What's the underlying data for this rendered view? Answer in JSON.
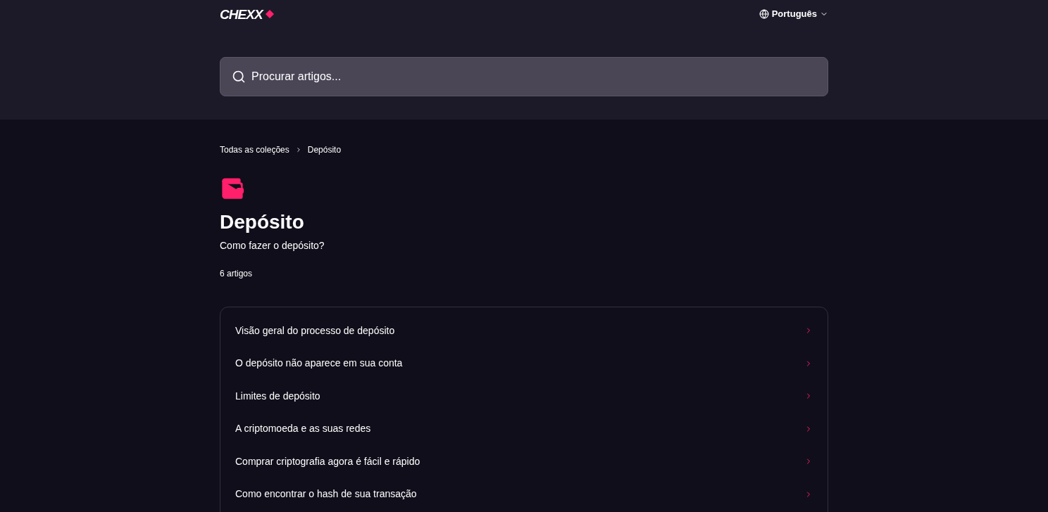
{
  "header": {
    "logo": "CHEXX",
    "language": "Português"
  },
  "search": {
    "placeholder": "Procurar artigos..."
  },
  "breadcrumbs": [
    "Todas as coleções",
    "Depósito"
  ],
  "collection": {
    "title": "Depósito",
    "description": "Como fazer o depósito?",
    "count": "6 artigos"
  },
  "articles": [
    "Visão geral do processo de depósito",
    "O depósito não aparece em sua conta",
    "Limites de depósito",
    "A criptomoeda e as suas redes",
    "Comprar criptografia agora é fácil e rápido",
    "Como encontrar o hash de sua transação"
  ]
}
